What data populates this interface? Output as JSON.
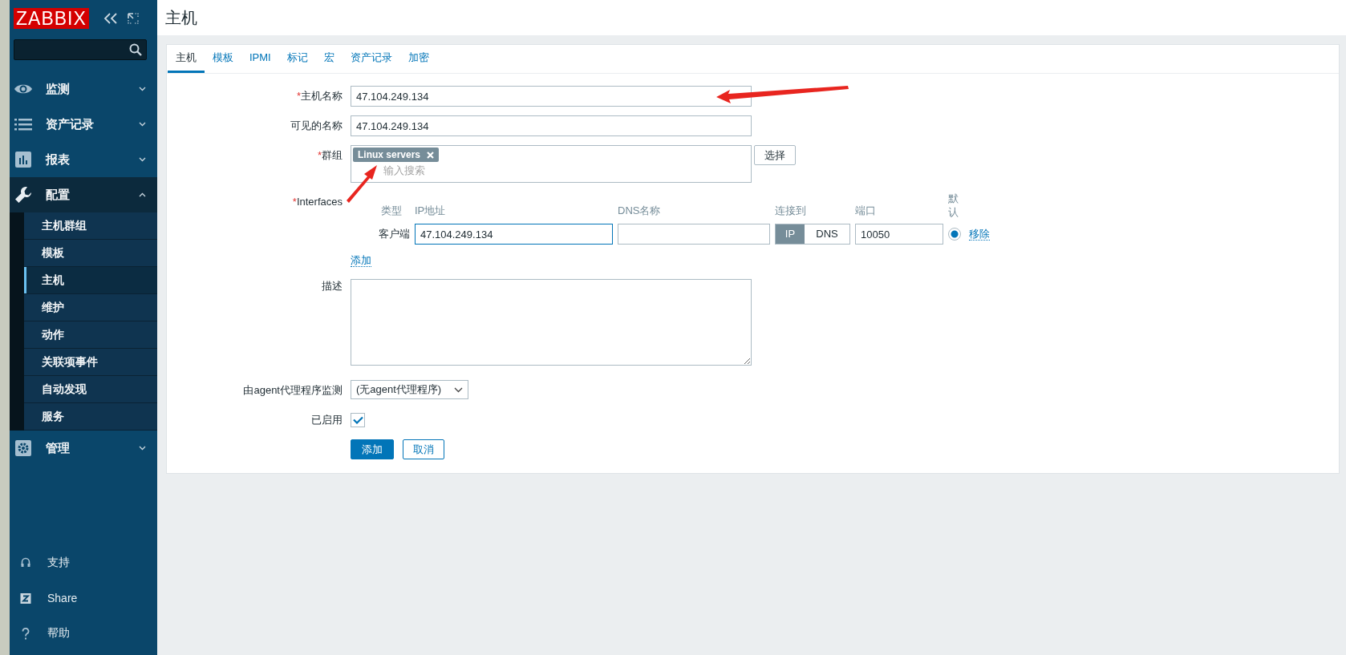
{
  "sidebar": {
    "logo": "ZABBIX",
    "menu": [
      {
        "label": "监测",
        "expanded": false
      },
      {
        "label": "资产记录",
        "expanded": false
      },
      {
        "label": "报表",
        "expanded": false
      },
      {
        "label": "配置",
        "expanded": true,
        "children": [
          {
            "label": "主机群组",
            "selected": false
          },
          {
            "label": "模板",
            "selected": false
          },
          {
            "label": "主机",
            "selected": true
          },
          {
            "label": "维护",
            "selected": false
          },
          {
            "label": "动作",
            "selected": false
          },
          {
            "label": "关联项事件",
            "selected": false
          },
          {
            "label": "自动发现",
            "selected": false
          },
          {
            "label": "服务",
            "selected": false
          }
        ]
      },
      {
        "label": "管理",
        "expanded": false
      }
    ],
    "footer_links": [
      "支持",
      "Share",
      "帮助"
    ]
  },
  "page_title": "主机",
  "tabs": [
    {
      "label": "主机",
      "selected": true
    },
    {
      "label": "模板",
      "selected": false
    },
    {
      "label": "IPMI",
      "selected": false
    },
    {
      "label": "标记",
      "selected": false
    },
    {
      "label": "宏",
      "selected": false
    },
    {
      "label": "资产记录",
      "selected": false
    },
    {
      "label": "加密",
      "selected": false
    }
  ],
  "required_mark": "*",
  "form": {
    "host_name": {
      "label": "主机名称",
      "required": true,
      "value": "47.104.249.134"
    },
    "visible_name": {
      "label": "可见的名称",
      "required": false,
      "value": "47.104.249.134"
    },
    "groups": {
      "label": "群组",
      "required": true,
      "tags": [
        "Linux servers"
      ],
      "placeholder": "输入搜索",
      "button": "选择"
    },
    "interfaces": {
      "label": "Interfaces",
      "required": true,
      "columns": [
        "类型",
        "IP地址",
        "DNS名称",
        "连接到",
        "端口",
        "默认"
      ],
      "rows": [
        {
          "type": "客户端",
          "ip": "47.104.249.134",
          "connect": [
            {
              "label": "IP",
              "selected": true
            },
            {
              "label": "DNS",
              "selected": false
            }
          ],
          "port": "10050",
          "default": true,
          "remove": "移除"
        }
      ],
      "add": "添加"
    },
    "description": {
      "label": "描述"
    },
    "proxy": {
      "label": "由agent代理程序监测",
      "value": "(无agent代理程序)"
    },
    "enabled": {
      "label": "已启用",
      "checked": true
    },
    "buttons": [
      {
        "label": "添加",
        "primary": true
      },
      {
        "label": "取消",
        "primary": false
      }
    ]
  }
}
